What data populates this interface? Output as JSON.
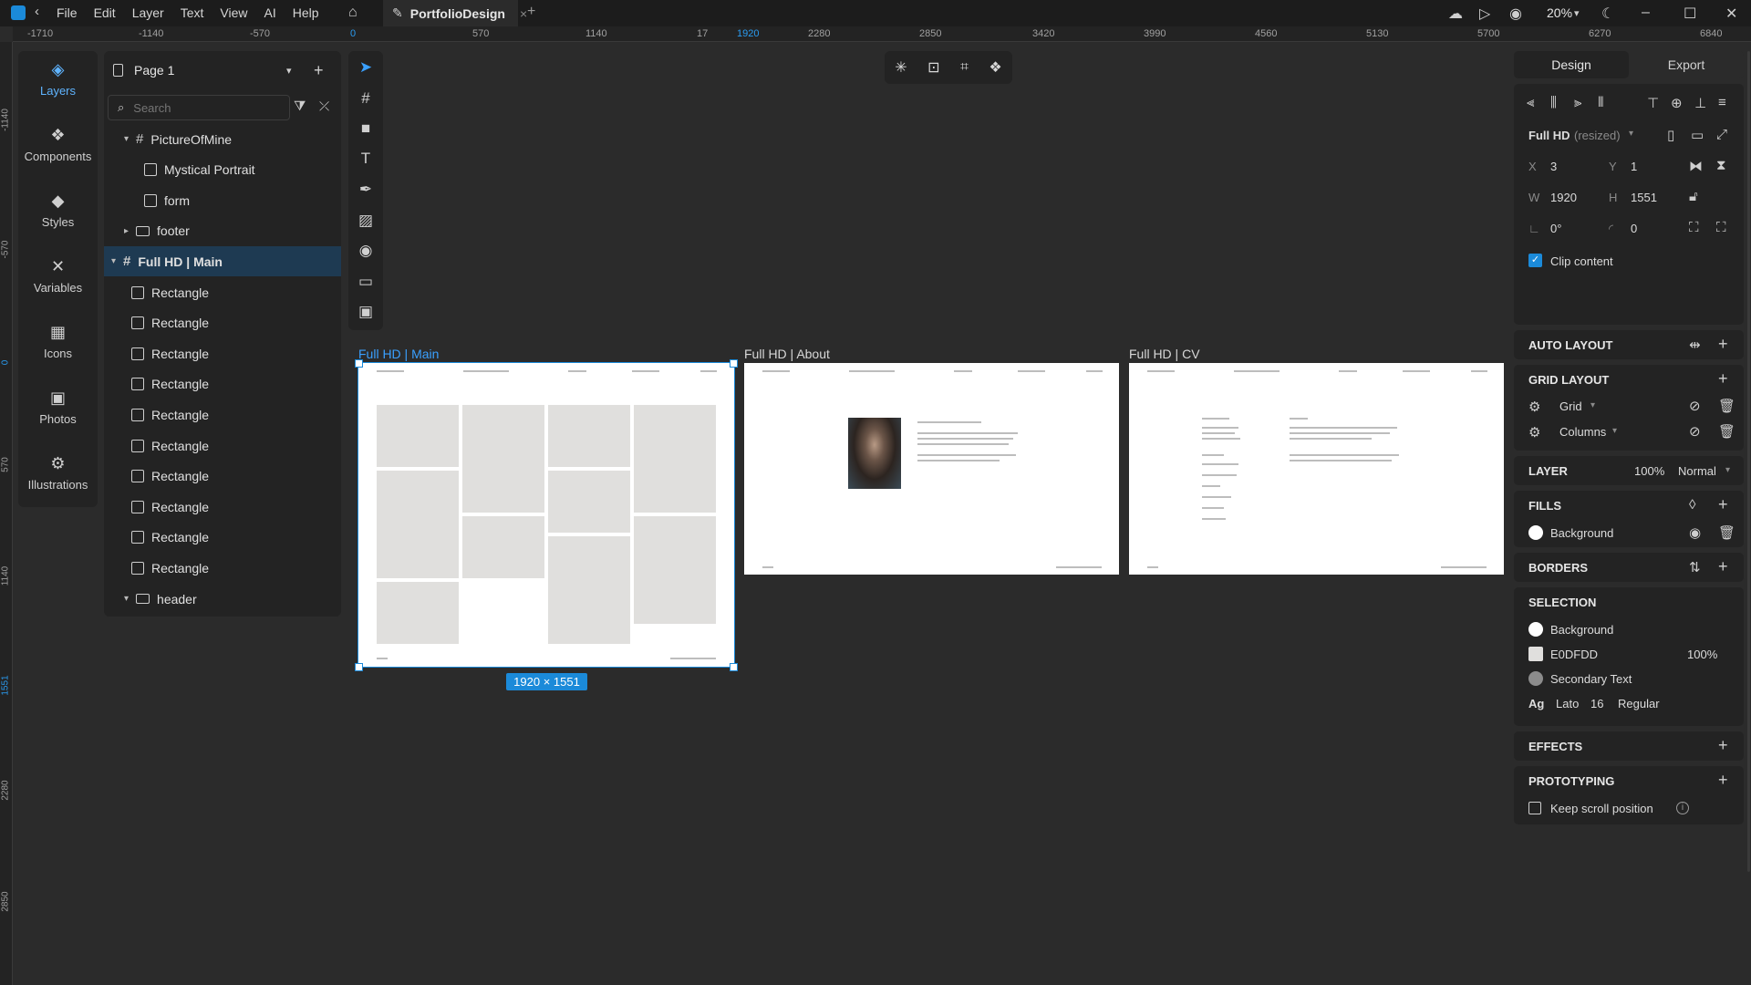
{
  "app": {
    "tab_title": "PortfolioDesign",
    "menu": [
      "File",
      "Edit",
      "Layer",
      "Text",
      "View",
      "AI",
      "Help"
    ],
    "zoom": "20%"
  },
  "rulers": {
    "top": [
      "-1710",
      "-1140",
      "-570",
      "0",
      "570",
      "1140",
      "17",
      "1920",
      "2280",
      "2850",
      "3420",
      "3990",
      "4560",
      "5130",
      "5700",
      "6270",
      "6840"
    ],
    "left": [
      "-1140",
      "-570",
      "0",
      "570",
      "1140",
      "1551",
      "2280",
      "2850"
    ]
  },
  "rail": [
    "Layers",
    "Components",
    "Styles",
    "Variables",
    "Icons",
    "Photos",
    "Illustrations"
  ],
  "layers": {
    "page": "Page 1",
    "search_placeholder": "Search",
    "rows": [
      {
        "label": "PictureOfMine",
        "kind": "frame",
        "indent": 1,
        "arrow": "▾"
      },
      {
        "label": "Mystical Portrait",
        "kind": "image",
        "indent": 2
      },
      {
        "label": "form",
        "kind": "rect",
        "indent": 2
      },
      {
        "label": "footer",
        "kind": "folder",
        "indent": 1,
        "arrow": "▸"
      },
      {
        "label": "Full HD | Main",
        "kind": "frame",
        "indent": 0,
        "arrow": "▾",
        "selected": true
      },
      {
        "label": "Rectangle",
        "kind": "rect",
        "indent": 1
      },
      {
        "label": "Rectangle",
        "kind": "rect",
        "indent": 1
      },
      {
        "label": "Rectangle",
        "kind": "rect",
        "indent": 1
      },
      {
        "label": "Rectangle",
        "kind": "rect",
        "indent": 1
      },
      {
        "label": "Rectangle",
        "kind": "rect",
        "indent": 1
      },
      {
        "label": "Rectangle",
        "kind": "rect",
        "indent": 1
      },
      {
        "label": "Rectangle",
        "kind": "rect",
        "indent": 1
      },
      {
        "label": "Rectangle",
        "kind": "rect",
        "indent": 1
      },
      {
        "label": "Rectangle",
        "kind": "rect",
        "indent": 1
      },
      {
        "label": "Rectangle",
        "kind": "rect",
        "indent": 1
      },
      {
        "label": "header",
        "kind": "folder",
        "indent": 1,
        "arrow": "▾"
      }
    ]
  },
  "artboards": {
    "main_label": "Full HD | Main",
    "about_label": "Full HD | About",
    "cv_label": "Full HD | CV",
    "size_badge": "1920 × 1551"
  },
  "design_panel": {
    "tabs": [
      "Design",
      "Export"
    ],
    "frame_name": "Full HD",
    "frame_state": "(resized)",
    "x_label": "X",
    "x": "3",
    "y_label": "Y",
    "y": "1",
    "w_label": "W",
    "w": "1920",
    "h_label": "H",
    "h": "1551",
    "rotation": "0°",
    "radius": "0",
    "clip_content": "Clip content",
    "auto_layout": "AUTO LAYOUT",
    "grid_layout": "GRID LAYOUT",
    "grid": "Grid",
    "columns": "Columns",
    "layer": "LAYER",
    "layer_opacity": "100%",
    "blend": "Normal",
    "fills": "FILLS",
    "fill_name": "Background",
    "borders": "BORDERS",
    "selection": "SELECTION",
    "sel_items": [
      {
        "name": "Background",
        "color": "#ffffff"
      },
      {
        "name": "E0DFDD",
        "color": "#e0dfdd",
        "opacity": "100%"
      },
      {
        "name": "Secondary Text",
        "color": "#8c8c8c"
      }
    ],
    "font_ag": "Ag",
    "font_family": "Lato",
    "font_size": "16",
    "font_weight": "Regular",
    "effects": "EFFECTS",
    "prototyping": "PROTOTYPING",
    "keep_scroll": "Keep scroll position"
  },
  "colors": {
    "accent": "#1b8ad9",
    "panel": "#232323",
    "canvas": "#2b2b2b",
    "placeholder": "#e0dfdd"
  }
}
